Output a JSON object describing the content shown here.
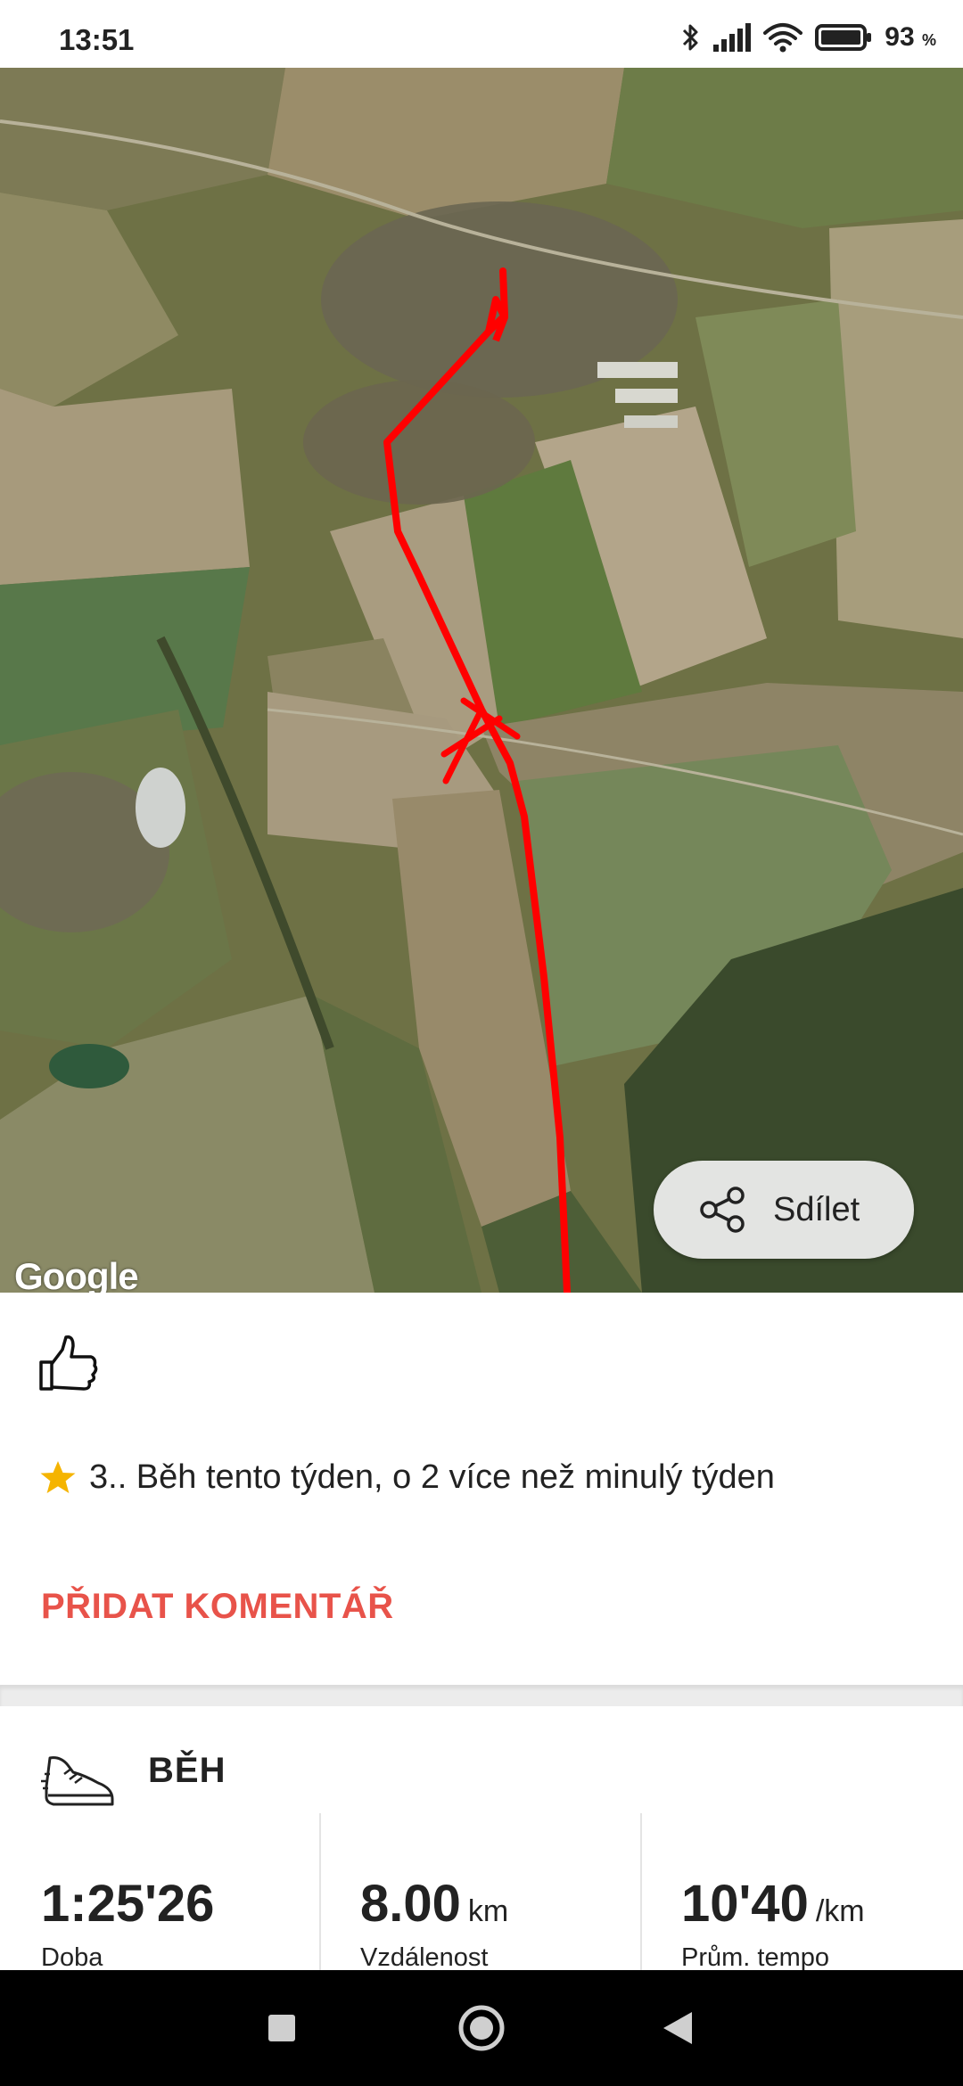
{
  "status_bar": {
    "time": "13:51",
    "battery_percent": "93",
    "battery_unit": "%",
    "icons": [
      "bluetooth-icon",
      "signal-icon",
      "wifi-icon",
      "battery-icon"
    ]
  },
  "map": {
    "provider_logo": "Google",
    "route_color": "#ff0000",
    "share_label": "Sdílet",
    "share_icon": "share-icon"
  },
  "activity": {
    "like_icon": "thumbs-up-icon",
    "achievement_icon": "star-icon",
    "achievement_text": "3.. Běh tento týden, o 2 více než minulý týden",
    "add_comment_label": "PŘIDAT KOMENTÁŘ",
    "accent_color": "#e8534a"
  },
  "stats": {
    "sport_icon": "running-shoe-icon",
    "sport_title": "BĚH",
    "items": [
      {
        "value": "1:25'26",
        "unit": "",
        "label": "Doba"
      },
      {
        "value": "8.00",
        "unit": "km",
        "label": "Vzdálenost"
      },
      {
        "value": "10'40",
        "unit": "/km",
        "label": "Prům. tempo"
      }
    ]
  },
  "nav_bar": {
    "buttons": [
      "recents-button",
      "home-button",
      "back-button"
    ]
  }
}
